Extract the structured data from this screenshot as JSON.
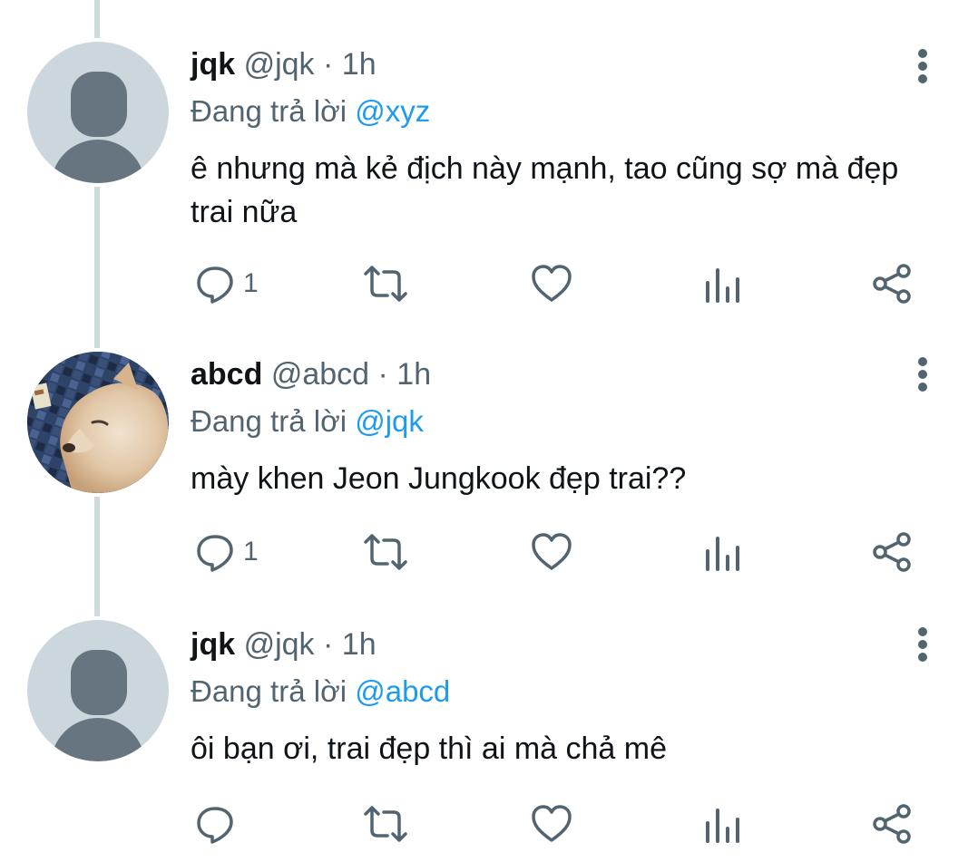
{
  "tweets": [
    {
      "name": "jqk",
      "handle": "@jqk",
      "separator": "·",
      "time": "1h",
      "reply_prefix": "Đang trả lời",
      "reply_to": "@xyz",
      "text": "ê nhưng mà kẻ địch này mạnh, tao cũng sợ mà đẹp trai nữa",
      "reply_count": "1",
      "avatar": "default-profile-icon"
    },
    {
      "name": "abcd",
      "handle": "@abcd",
      "separator": "·",
      "time": "1h",
      "reply_prefix": "Đang trả lời",
      "reply_to": "@jqk",
      "text": "mày khen Jeon Jungkook đẹp trai??",
      "reply_count": "1",
      "avatar": "dog-photo"
    },
    {
      "name": "jqk",
      "handle": "@jqk",
      "separator": "·",
      "time": "1h",
      "reply_prefix": "Đang trả lời",
      "reply_to": "@abcd",
      "text": "ôi bạn ơi, trai đẹp thì ai mà chả mê",
      "reply_count": "",
      "avatar": "default-profile-icon"
    }
  ],
  "icons": {
    "reply": "reply-icon",
    "retweet": "retweet-icon",
    "like": "like-icon",
    "views": "views-icon",
    "share": "share-icon",
    "more": "more-icon"
  },
  "colors": {
    "text": "#0f1419",
    "secondary": "#536471",
    "mention": "#1d9bf0",
    "thread_line": "#cfd9de",
    "avatar_bg": "#ccd6dd",
    "avatar_fg": "#66757f"
  }
}
